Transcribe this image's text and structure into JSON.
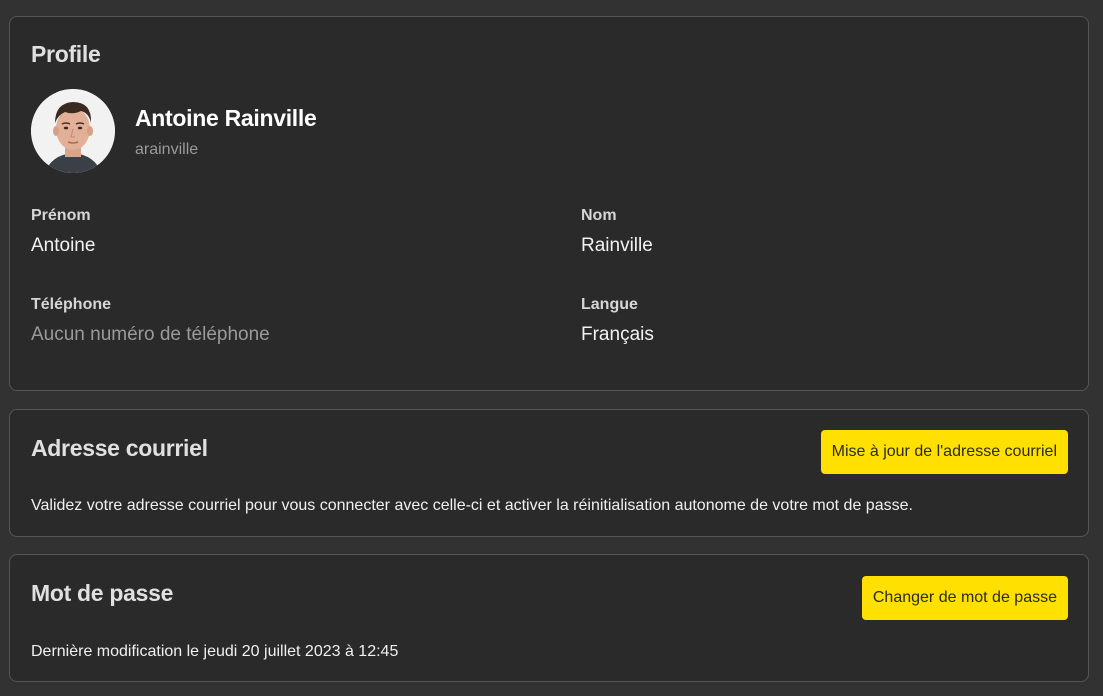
{
  "profile": {
    "title": "Profile",
    "user": {
      "full_name": "Antoine Rainville",
      "username": "arainville"
    },
    "fields": {
      "first_name": {
        "label": "Prénom",
        "value": "Antoine"
      },
      "last_name": {
        "label": "Nom",
        "value": "Rainville"
      },
      "phone": {
        "label": "Téléphone",
        "value": "Aucun numéro de téléphone"
      },
      "language": {
        "label": "Langue",
        "value": "Français"
      }
    }
  },
  "email": {
    "title": "Adresse courriel",
    "button_label": "Mise à jour de l'adresse courriel",
    "description": "Validez votre adresse courriel pour vous connecter avec celle-ci et activer la réinitialisation autonome de votre mot de passe."
  },
  "password": {
    "title": "Mot de passe",
    "button_label": "Changer de mot de passe",
    "description": "Dernière modification le jeudi 20 juillet 2023 à 12:45"
  },
  "colors": {
    "page_background": "#323232",
    "card_background": "#2a2a2a",
    "card_border": "#555555",
    "accent_button": "#ffe000",
    "muted_text": "#9a9a9a"
  }
}
